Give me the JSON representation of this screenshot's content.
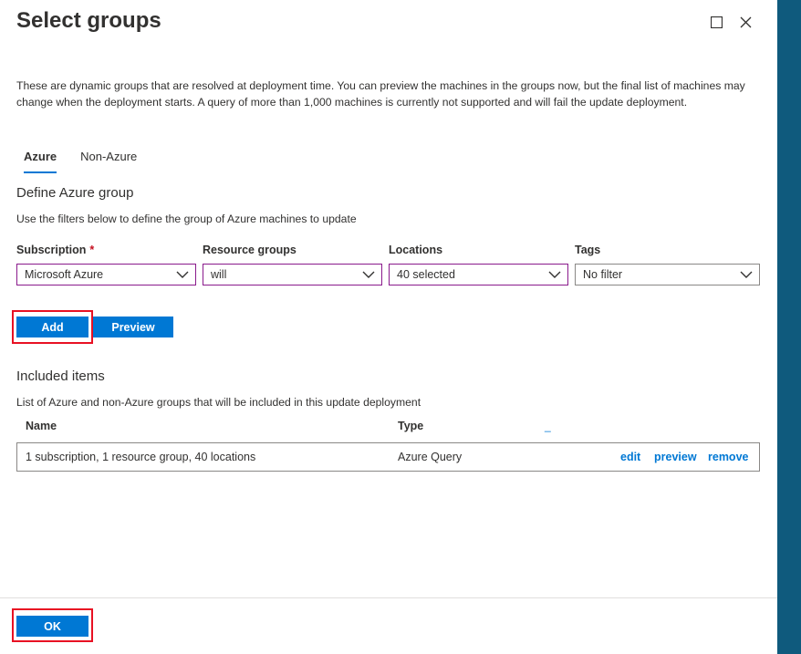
{
  "window": {
    "title": "Select groups",
    "maximize_icon": "maximize-icon",
    "close_icon": "close-icon"
  },
  "intro_text": "These are dynamic groups that are resolved at deployment time. You can preview the machines in the groups now, but the final list of machines may change when the deployment starts. A query of more than 1,000 machines is currently not supported and will fail the update deployment.",
  "tabs": [
    {
      "label": "Azure",
      "active": true
    },
    {
      "label": "Non-Azure",
      "active": false
    }
  ],
  "define_group": {
    "title": "Define Azure group",
    "description": "Use the filters below to define the group of Azure machines to update"
  },
  "filters": {
    "subscription": {
      "label": "Subscription",
      "required_mark": "*",
      "value": "Microsoft Azure"
    },
    "resource_groups": {
      "label": "Resource groups",
      "value": "will"
    },
    "locations": {
      "label": "Locations",
      "value": "40 selected"
    },
    "tags": {
      "label": "Tags",
      "value": "No filter"
    }
  },
  "actions": {
    "add_label": "Add",
    "preview_label": "Preview"
  },
  "included": {
    "title": "Included items",
    "description": "List of Azure and non-Azure groups that will be included in this update deployment",
    "columns": [
      "Name",
      "Type"
    ],
    "extra_link": "_",
    "rows": [
      {
        "name": "1 subscription, 1 resource group, 40 locations",
        "type": "Azure Query",
        "actions": [
          "edit",
          "preview",
          "remove"
        ]
      }
    ]
  },
  "footer": {
    "ok_label": "OK"
  },
  "colors": {
    "accent": "#0078d4",
    "highlight": "#e81123",
    "side_strip": "#0f5a7d",
    "focus_border": "#8a1a8c"
  }
}
